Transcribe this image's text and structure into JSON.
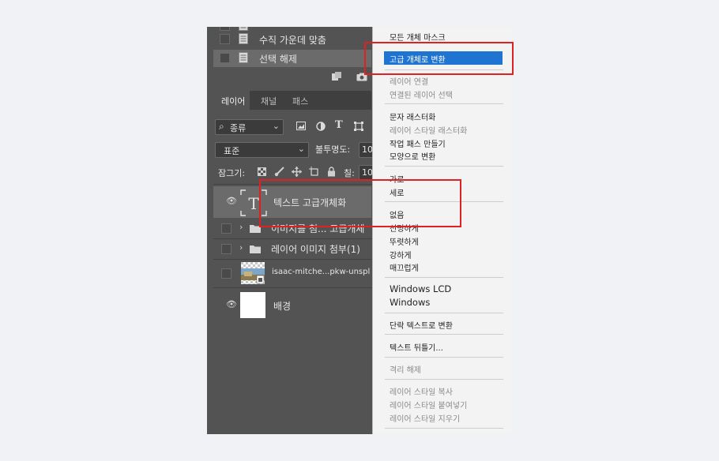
{
  "history": {
    "items": [
      {
        "label": "수직 가운데 맞춤",
        "selected": false
      },
      {
        "label": "선택 해제",
        "selected": true
      }
    ]
  },
  "layers_panel": {
    "tabs": [
      "레이어",
      "채널",
      "패스"
    ],
    "filter_select": "종류",
    "blend_mode": "표준",
    "opacity_label": "불투명도:",
    "opacity_value": "10",
    "lock_label": "잠그기:",
    "fill_label": "칠:",
    "fill_value": "10",
    "layers": [
      {
        "name": "텍스트 고급개체화",
        "type": "text",
        "visible": true
      },
      {
        "name": "이미지를 첨... 고급개체",
        "type": "group",
        "visible": false
      },
      {
        "name": "레이어 이미지 첨부(1)",
        "type": "group",
        "visible": false
      },
      {
        "name": "isaac-mitche...pkw-unspl",
        "type": "smart-object",
        "visible": false
      },
      {
        "name": "배경",
        "type": "background",
        "visible": true
      }
    ]
  },
  "context_menu": {
    "items": [
      {
        "label": "모든 개체 마스크",
        "enabled": true
      },
      {
        "label": "고급 개체로 변환",
        "enabled": true,
        "highlighted": true
      },
      {
        "label": "레이어 연결",
        "enabled": false
      },
      {
        "label": "연결된 레이어 선택",
        "enabled": false
      },
      {
        "label": "문자 래스터화",
        "enabled": true
      },
      {
        "label": "레이어 스타일 래스터화",
        "enabled": false
      },
      {
        "label": "작업 패스 만들기",
        "enabled": true
      },
      {
        "label": "모양으로 변환",
        "enabled": true
      },
      {
        "label": "가로",
        "enabled": true
      },
      {
        "label": "세로",
        "enabled": true
      },
      {
        "label": "없음",
        "enabled": true
      },
      {
        "label": "선명하게",
        "enabled": true
      },
      {
        "label": "뚜렷하게",
        "enabled": true
      },
      {
        "label": "강하게",
        "enabled": true
      },
      {
        "label": "매끄럽게",
        "enabled": true
      },
      {
        "label": "Windows LCD",
        "enabled": true
      },
      {
        "label": "Windows",
        "enabled": true
      },
      {
        "label": "단락 텍스트로 변환",
        "enabled": true
      },
      {
        "label": "텍스트 뒤틀기...",
        "enabled": true
      },
      {
        "label": "격리 해제",
        "enabled": false
      },
      {
        "label": "레이어 스타일 복사",
        "enabled": false
      },
      {
        "label": "레이어 스타일 붙여넣기",
        "enabled": false
      },
      {
        "label": "레이어 스타일 지우기",
        "enabled": false
      }
    ]
  },
  "colors": {
    "panel_bg": "#535353",
    "menu_bg": "#f3f3f3",
    "highlight": "#1f74d1",
    "annotation_red": "#e02121"
  }
}
